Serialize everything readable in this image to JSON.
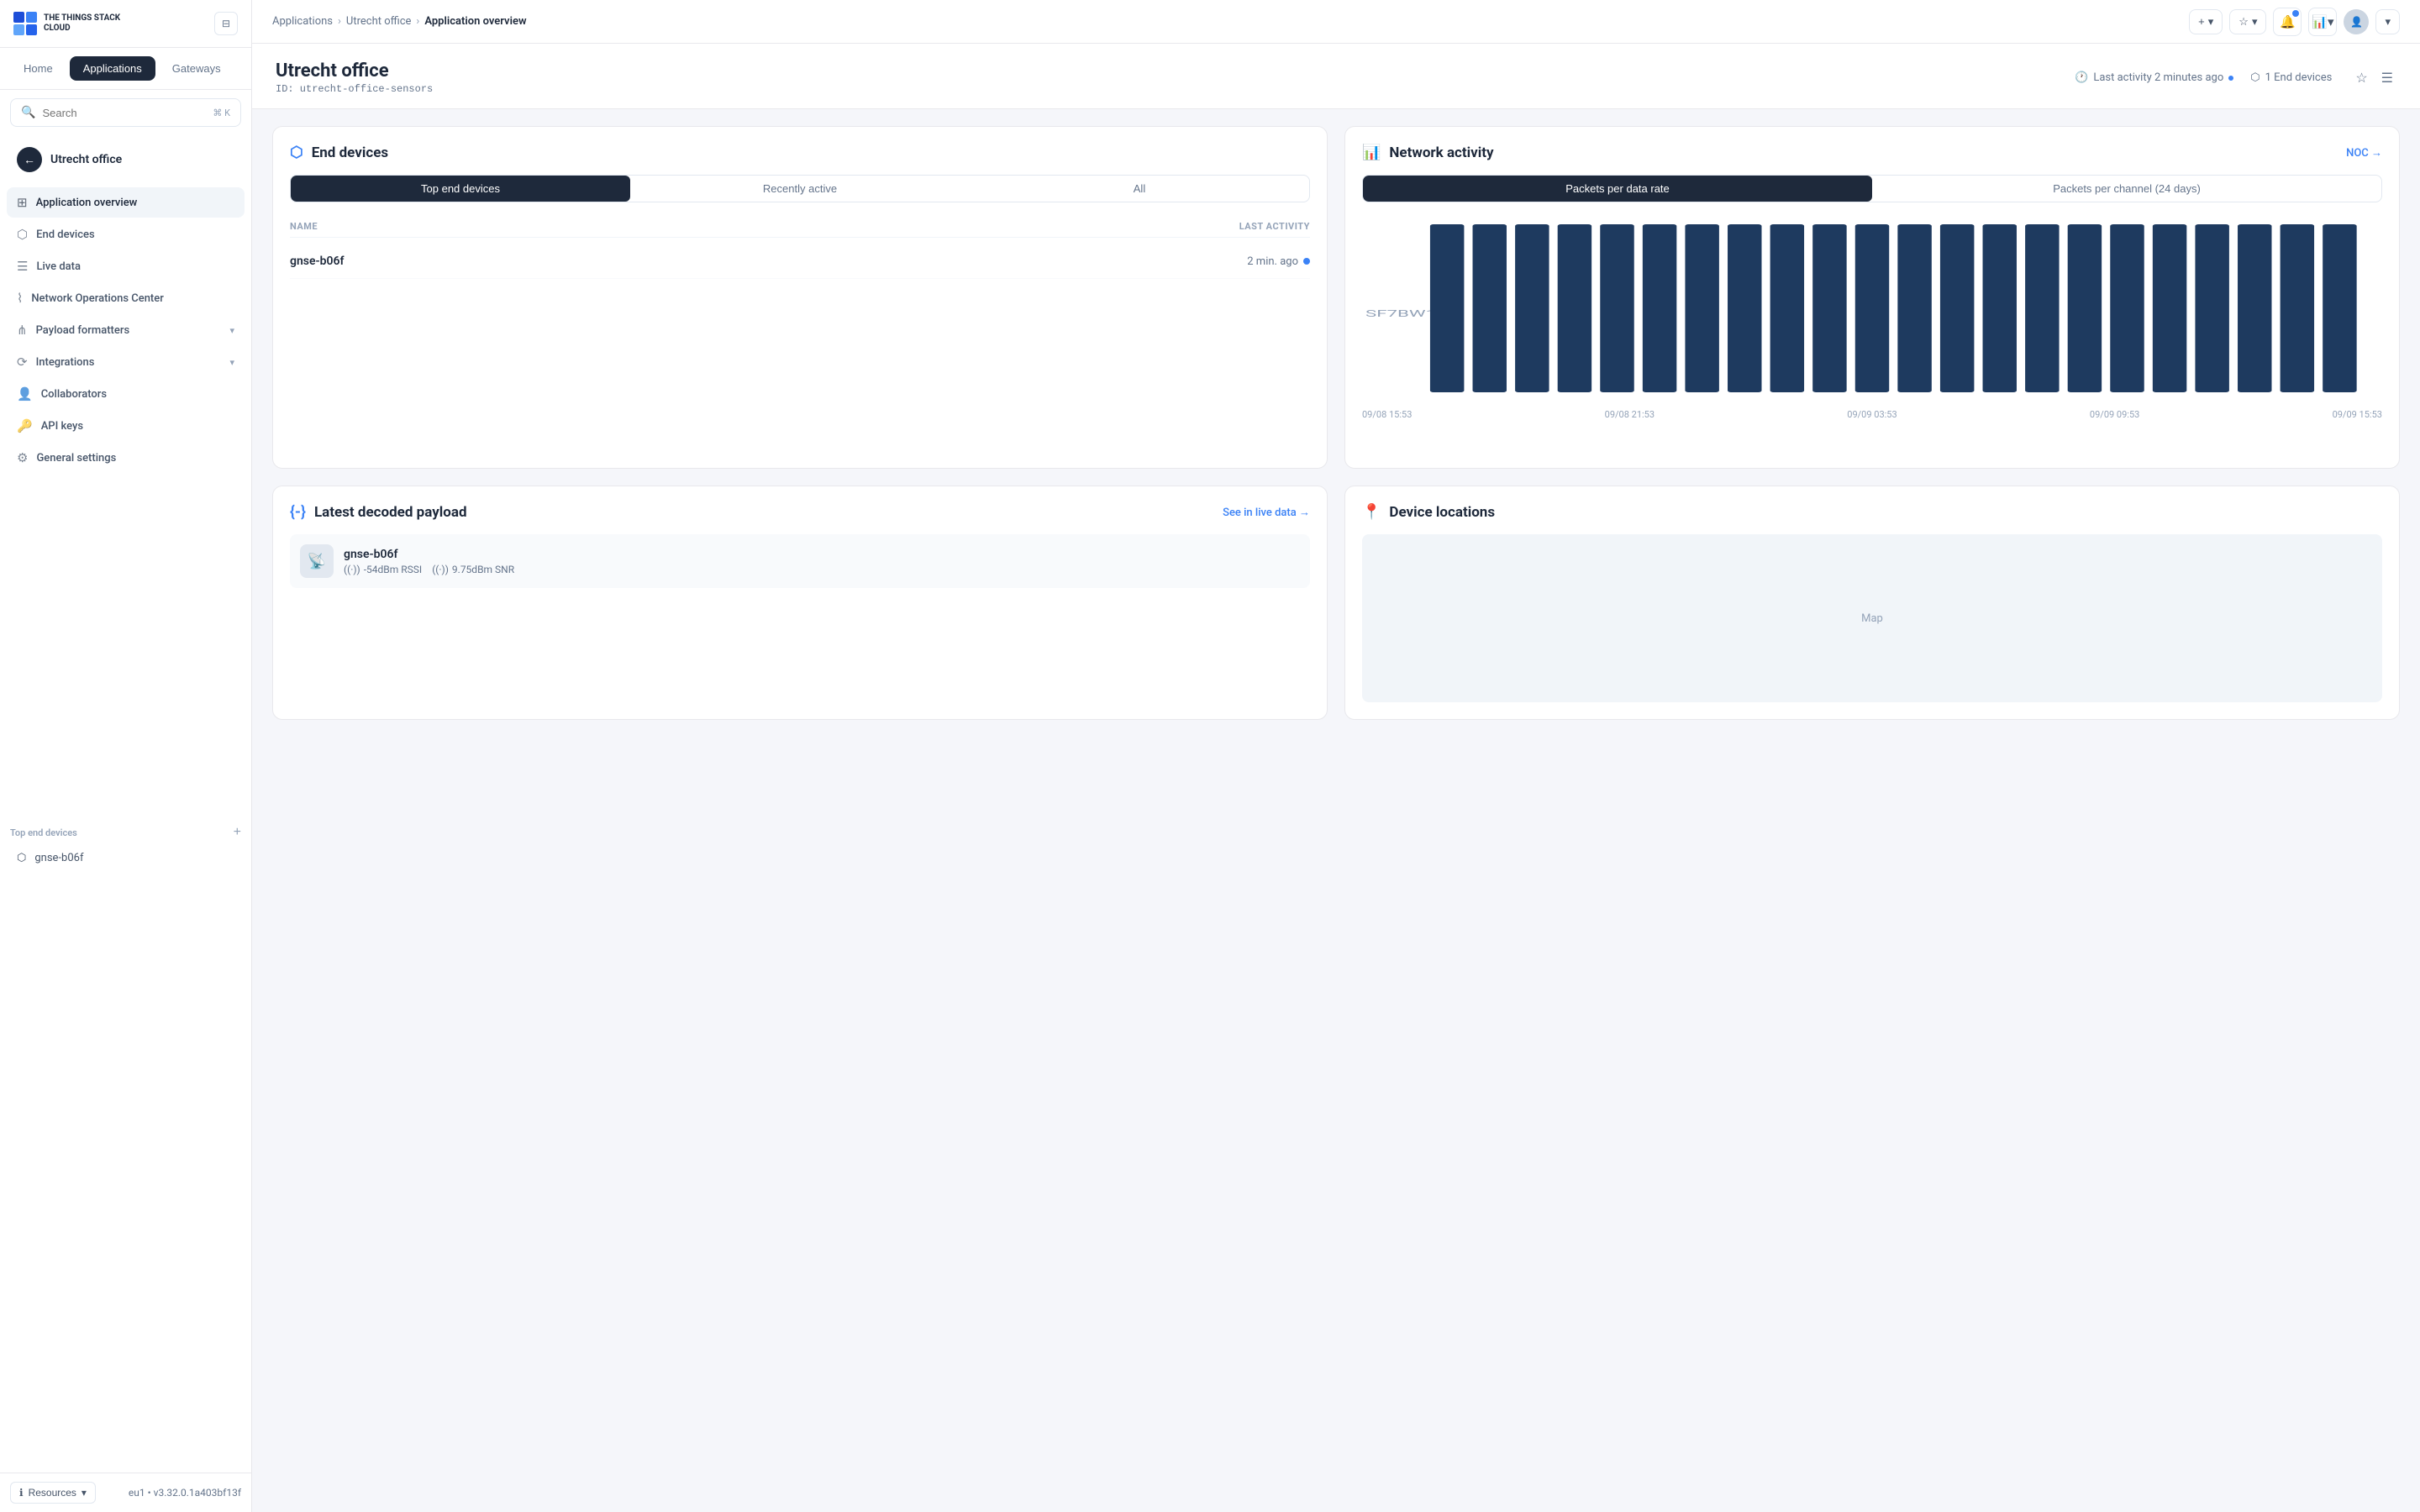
{
  "app": {
    "logo_line1": "THE THINGS STACK",
    "logo_line2": "CLOUD"
  },
  "sidebar": {
    "nav_tabs": [
      {
        "id": "home",
        "label": "Home"
      },
      {
        "id": "applications",
        "label": "Applications"
      },
      {
        "id": "gateways",
        "label": "Gateways"
      }
    ],
    "search_placeholder": "Search",
    "search_shortcut": "⌘ K",
    "back_label": "Utrecht office",
    "menu_items": [
      {
        "id": "overview",
        "label": "Application overview",
        "icon": "⊞"
      },
      {
        "id": "end-devices",
        "label": "End devices",
        "icon": "⬡"
      },
      {
        "id": "live-data",
        "label": "Live data",
        "icon": "☰"
      },
      {
        "id": "noc",
        "label": "Network Operations Center",
        "icon": "⌇"
      },
      {
        "id": "payload-formatters",
        "label": "Payload formatters",
        "icon": "⋔",
        "has_chevron": true
      },
      {
        "id": "integrations",
        "label": "Integrations",
        "icon": "⟳",
        "has_chevron": true
      },
      {
        "id": "collaborators",
        "label": "Collaborators",
        "icon": "👤"
      },
      {
        "id": "api-keys",
        "label": "API keys",
        "icon": "🔑"
      },
      {
        "id": "general-settings",
        "label": "General settings",
        "icon": "⚙"
      }
    ],
    "section_title": "Top end devices",
    "devices": [
      {
        "id": "gnse-b06f",
        "label": "gnse-b06f",
        "icon": "⬡"
      }
    ],
    "footer": {
      "resources_label": "Resources",
      "version_label": "eu1 • v3.32.0.1a403bf13f"
    }
  },
  "topbar": {
    "breadcrumb": {
      "applications": "Applications",
      "application": "Utrecht office",
      "current": "Application overview"
    },
    "actions": {
      "add_label": "+",
      "bookmark_label": "☆",
      "notifications_label": "🔔",
      "dashboard_label": "📊"
    }
  },
  "page_header": {
    "title": "Utrecht office",
    "id": "ID: utrecht-office-sensors",
    "last_activity": "Last activity 2 minutes ago",
    "end_devices_count": "1 End devices"
  },
  "end_devices_card": {
    "title": "End devices",
    "tabs": [
      {
        "id": "top",
        "label": "Top end devices"
      },
      {
        "id": "recent",
        "label": "Recently active"
      },
      {
        "id": "all",
        "label": "All"
      }
    ],
    "table_headers": {
      "name": "NAME",
      "last_activity": "LAST ACTIVITY"
    },
    "devices": [
      {
        "name": "gnse-b06f",
        "last_activity": "2 min. ago",
        "active": true
      }
    ]
  },
  "network_activity_card": {
    "title": "Network activity",
    "noc_link": "NOC →",
    "tabs": [
      {
        "id": "data-rate",
        "label": "Packets per data rate"
      },
      {
        "id": "channel",
        "label": "Packets per channel (24 days)"
      }
    ],
    "y_label": "SF7BW1...",
    "x_labels": [
      "09/08 15:53",
      "09/08 21:53",
      "09/09 03:53",
      "09/09 09:53",
      "09/09 15:53"
    ],
    "bar_count": 24
  },
  "latest_payload_card": {
    "title": "Latest decoded payload",
    "see_live_link": "See in live data →",
    "device": {
      "name": "gnse-b06f",
      "rssi": "-54dBm RSSI",
      "snr": "9.75dBm SNR"
    }
  },
  "device_locations_card": {
    "title": "Device locations"
  }
}
